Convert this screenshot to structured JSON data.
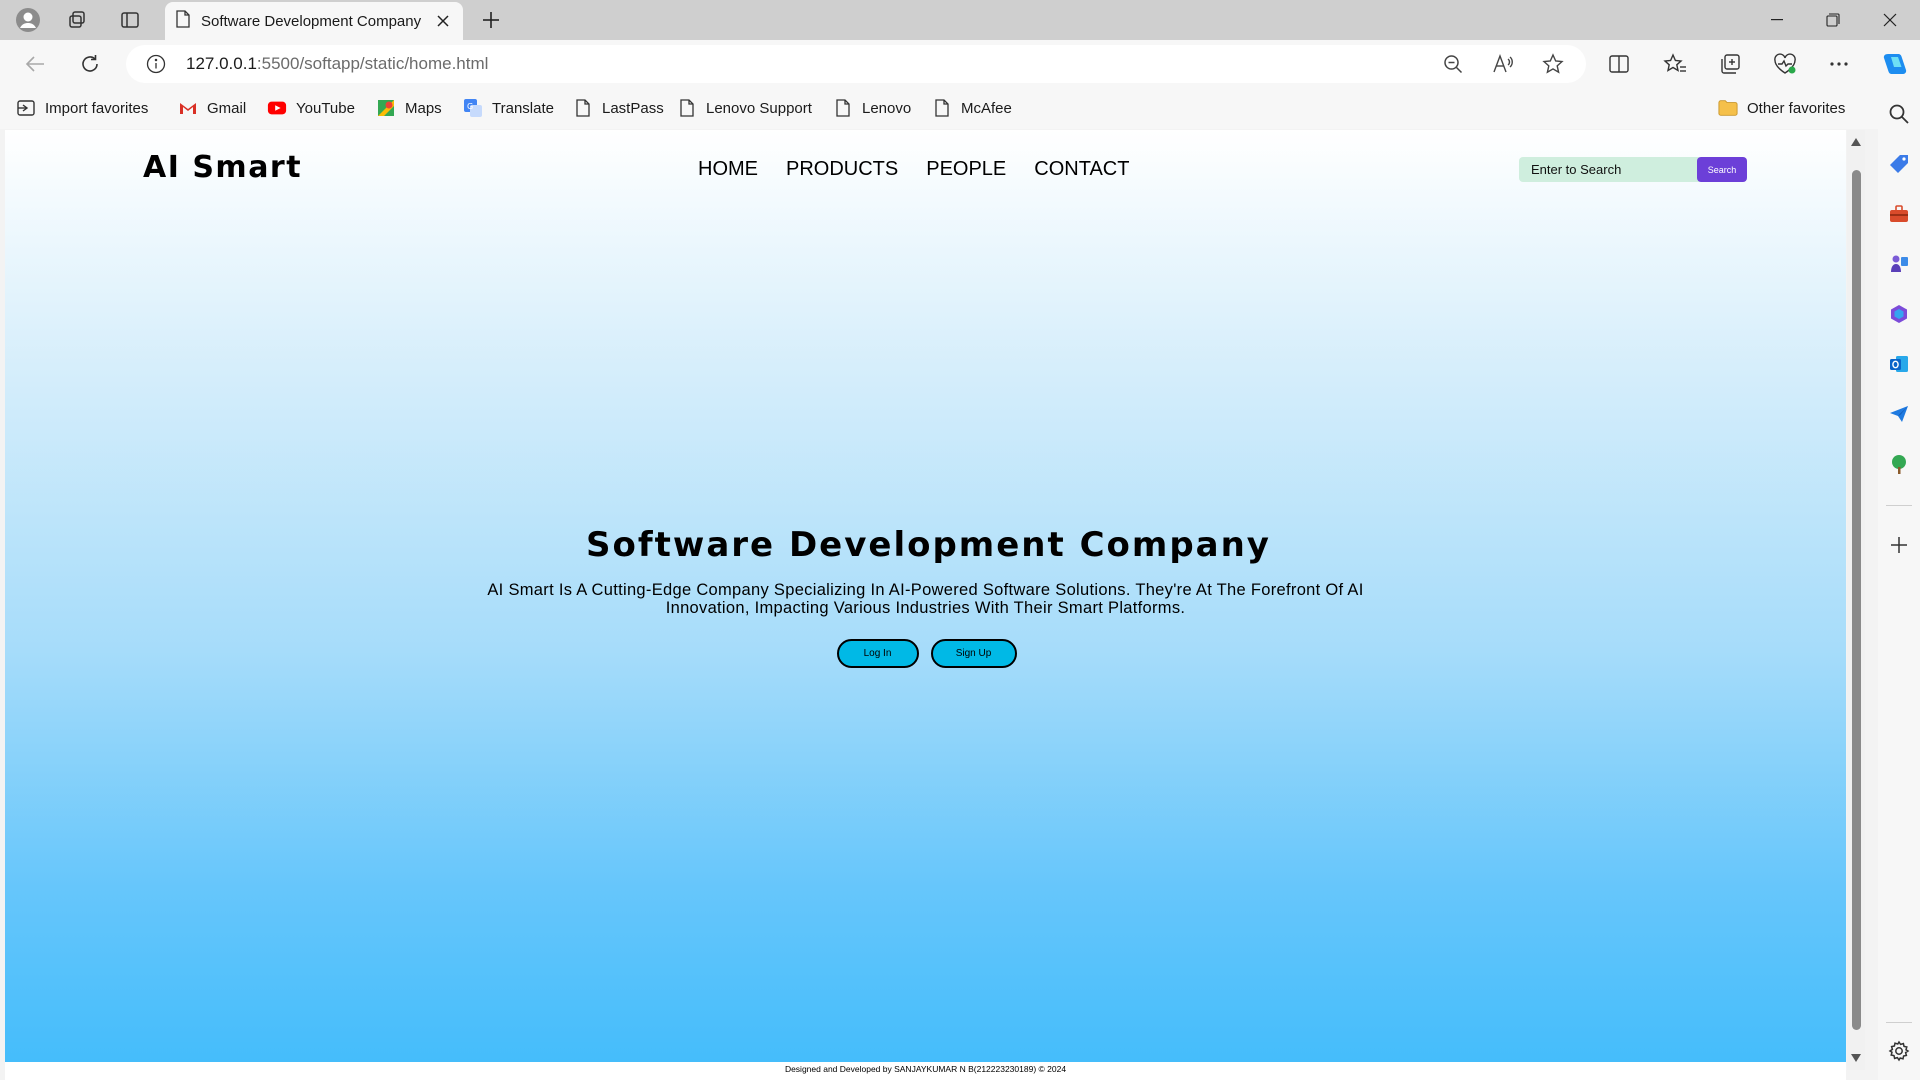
{
  "browser": {
    "tab_title": "Software Development Company",
    "url_host": "127.0.0.1",
    "url_path": ":5500/softapp/static/home.html"
  },
  "bookmarks": [
    {
      "label": "Import favorites",
      "icon": "import-icon"
    },
    {
      "label": "Gmail",
      "icon": "gmail-icon"
    },
    {
      "label": "YouTube",
      "icon": "youtube-icon"
    },
    {
      "label": "Maps",
      "icon": "maps-icon"
    },
    {
      "label": "Translate",
      "icon": "translate-icon"
    },
    {
      "label": "LastPass",
      "icon": "page-icon"
    },
    {
      "label": "Lenovo Support",
      "icon": "page-icon"
    },
    {
      "label": "Lenovo",
      "icon": "page-icon"
    },
    {
      "label": "McAfee",
      "icon": "page-icon"
    }
  ],
  "other_favorites": "Other favorites",
  "site": {
    "logo": "AI Smart",
    "nav": [
      "HOME",
      "PRODUCTS",
      "PEOPLE",
      "CONTACT"
    ],
    "search_placeholder": "Enter to Search",
    "search_button": "Search",
    "hero_title": "Software Development Company",
    "hero_text": "AI Smart Is A Cutting-Edge Company Specializing In AI-Powered Software Solutions. They're At The Forefront Of AI Innovation, Impacting Various Industries With Their Smart Platforms.",
    "login_button": "Log In",
    "signup_button": "Sign Up",
    "footer": "Designed and Developed by SANJAYKUMAR N B(212223230189) © 2024"
  },
  "colors": {
    "accent_purple": "#6c3fd8",
    "hero_button": "#00b9e6",
    "search_field": "#cfeede"
  }
}
